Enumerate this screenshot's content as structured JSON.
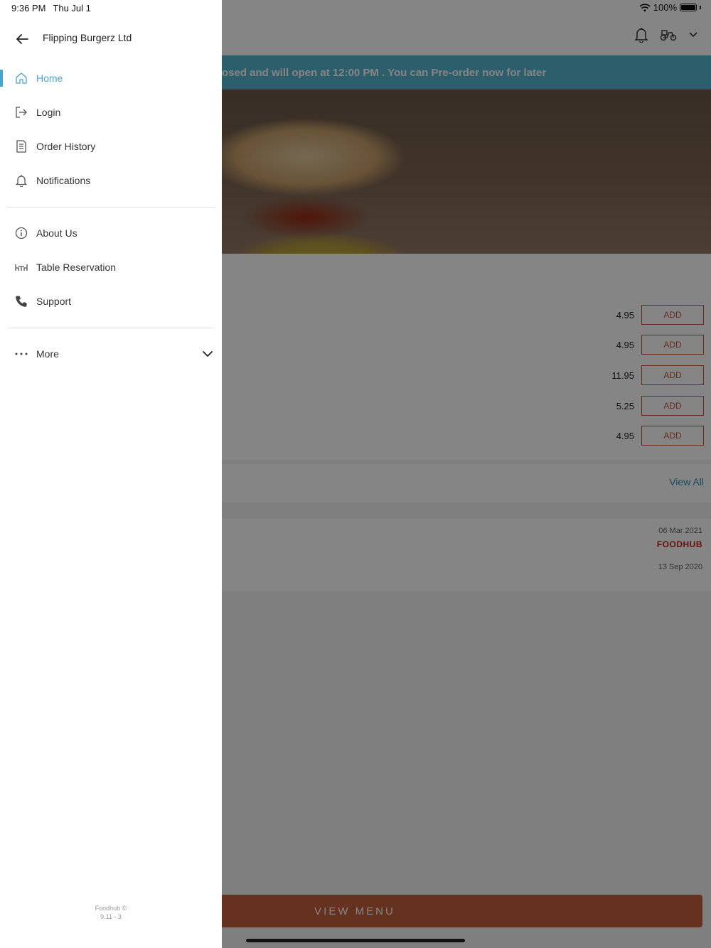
{
  "status": {
    "time": "9:36 PM",
    "date": "Thu Jul 1",
    "battery": "100%"
  },
  "background": {
    "banner_text": "osed and will open at 12:00 PM . You can Pre-order now for later",
    "menu_items": [
      {
        "price": "4.95",
        "add_label": "ADD"
      },
      {
        "price": "4.95",
        "add_label": "ADD"
      },
      {
        "price": "11.95",
        "add_label": "ADD"
      },
      {
        "price": "5.25",
        "add_label": "ADD"
      },
      {
        "price": "4.95",
        "add_label": "ADD"
      }
    ],
    "view_all": "View All",
    "reviews": [
      {
        "date": "06 Mar 2021",
        "source": "FOODHUB"
      },
      {
        "date": "13 Sep 2020"
      }
    ],
    "view_menu": "VIEW MENU"
  },
  "drawer": {
    "title": "Flipping Burgerz Ltd",
    "items": [
      {
        "label": "Home",
        "icon": "home-icon",
        "active": true
      },
      {
        "label": "Login",
        "icon": "login-icon"
      },
      {
        "label": "Order History",
        "icon": "receipt-icon"
      },
      {
        "label": "Notifications",
        "icon": "bell-icon"
      },
      {
        "label": "About Us",
        "icon": "info-icon"
      },
      {
        "label": "Table Reservation",
        "icon": "table-icon"
      },
      {
        "label": "Support",
        "icon": "phone-icon"
      },
      {
        "label": "More",
        "icon": "more-dots-icon"
      }
    ],
    "footer_line1": "Foodhub ©",
    "footer_line2": "9.11 - 3",
    "accent_color": "#4aa6c8"
  }
}
